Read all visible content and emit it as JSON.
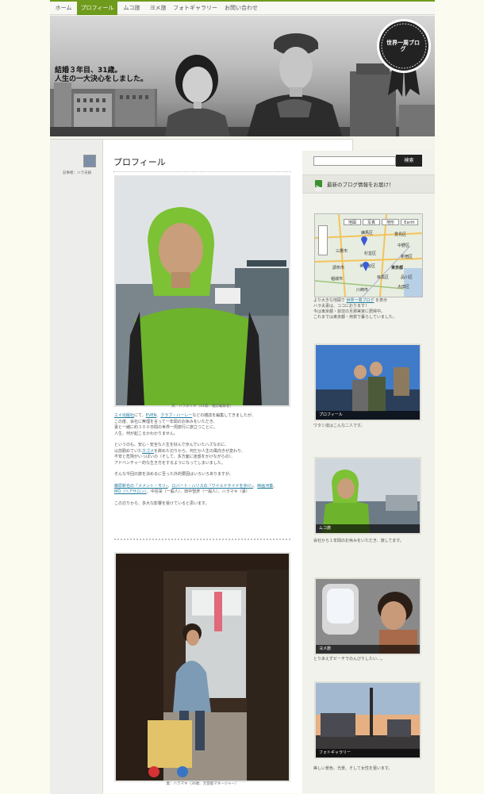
{
  "nav": {
    "items": [
      {
        "label": "ホーム",
        "active": false
      },
      {
        "label": "プロフィール",
        "active": true
      },
      {
        "label": "ムコ旅",
        "active": false
      },
      {
        "label": "ヨメ旅",
        "active": false
      },
      {
        "label": "フォトギャラリー",
        "active": false
      },
      {
        "label": "お問い合わせ",
        "active": false
      }
    ]
  },
  "header": {
    "tagline_line1": "結婚３年目、31歳。",
    "tagline_line2": "人生の一大決心をしました。",
    "badge_title": "世界一周ブログ"
  },
  "left": {
    "poster_label": "記事者：ハラ夫婦"
  },
  "main": {
    "page_title": "プロフィール",
    "photo1_caption": "夫：ハラダイチ（31歳、雑誌編集者）",
    "para1": [
      {
        "text": "エイ出版社",
        "link": true
      },
      {
        "text": "にて、",
        "link": false
      },
      {
        "text": "EVEN",
        "link": true
      },
      {
        "text": "、",
        "link": false
      },
      {
        "text": "クラブ・ハーレー",
        "link": true
      },
      {
        "text": "などの雑誌を編集してきましたが、",
        "link": false
      }
    ],
    "para1_lines": [
      "この度、会社に無理を言って一年間のお休みをいただき、",
      "妻と一緒に約３００日間の世界一周旅行に旅立つことに。",
      "人生、何が起こるかわかりません。"
    ],
    "para2_line1": "というのも、安心・安全な人生を好んで歩んでいたハズなのに、",
    "para2_line2_pre": "以前勤めていた",
    "para2_line2_link": "カゴメ",
    "para2_line2_post": "を辞めた辺りから、何だか人生の風向きが変わり、",
    "para2_line3": "不安と危険がいっぱいの（そして、多方面に迷惑をかけながらの）、",
    "para2_line4": "アドベンチャー的な生き方をするようになってしまいました。",
    "para3": "そんな今回の旅を決めるに至った外的要因はいろいろありますが、",
    "para4_link1": "藤原新也の『メメント・モリ』",
    "para4_sep1": "、",
    "para4_link2": "ロバート・ハリスの『ワイルドサイドを歩け』",
    "para4_sep2": "、",
    "para4_link3": "映画河童",
    "para4_sep3": "、",
    "para4_link4": "MÖ（ヘアサロン）",
    "para4_rest": "、中島栄（一般人）、田中智彦（一般人）、ハラマキ（妻）",
    "para5": "この辺りから、多大な影響を受けていると思います。",
    "photo2_caption": "妻：ハラマキ（30歳、元芸能マネージャー）"
  },
  "sidebar": {
    "search_button": "検索",
    "rss_label": "最新のブログ情報をお届け！",
    "map_tabs": [
      "地図",
      "写真",
      "地形",
      "Earth"
    ],
    "map_place_labels": [
      "練馬区",
      "豊島区",
      "中野区",
      "三鷹市",
      "杉並区",
      "新宿区",
      "世田谷区",
      "東京都",
      "品川区",
      "目黒区",
      "大田区",
      "調布市",
      "稲城市",
      "川崎市"
    ],
    "map_caption_line1_pre": "より大きな地図で ",
    "map_caption_line1_link": "世界一周ブログ",
    "map_caption_line1_post": " を表示",
    "map_caption_line2": "ハラ夫妻は、ココにおります！",
    "map_caption_line3": "今は東京都・荻窪の旦那実家に居候中。",
    "map_caption_line4": "これまでは東京都・用賀で暮らしていました。",
    "thumbs": [
      {
        "label": "プロフィール",
        "caption": "ワタシ達はこんな二人です。"
      },
      {
        "label": "ムコ旅",
        "caption": "会社から１年間のお休みをいただき、旅してます。"
      },
      {
        "label": "ヨメ旅",
        "caption": "とりあえずビーチでのんびりしたい…。"
      },
      {
        "label": "フォトギャラリー",
        "caption": "美しい景色、光景、そして女性を狙います。"
      }
    ],
    "colors": {
      "accent": "#6f9b1c",
      "link": "#1f7a9d"
    }
  }
}
